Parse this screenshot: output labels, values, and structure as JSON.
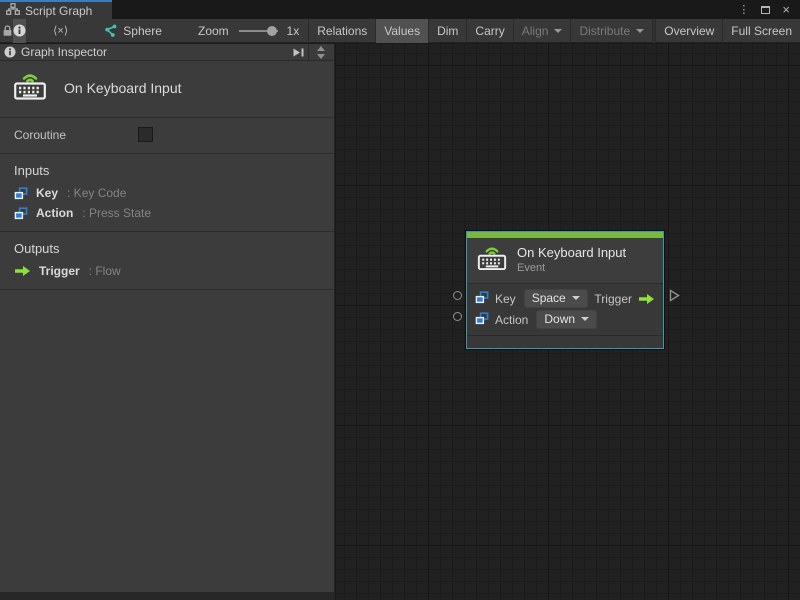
{
  "window": {
    "tab_label": "Script Graph",
    "menu_glyph": "⋮",
    "close_glyph": "×"
  },
  "toolbar": {
    "sphere_label": "Sphere",
    "zoom_label": "Zoom",
    "zoom_value": "1x",
    "code_glyph": "⟨×⟩",
    "buttons": [
      {
        "label": "Relations",
        "state": "normal"
      },
      {
        "label": "Values",
        "state": "selected"
      },
      {
        "label": "Dim",
        "state": "normal"
      },
      {
        "label": "Carry",
        "state": "normal"
      },
      {
        "label": "Align",
        "state": "disabled",
        "caret": true
      },
      {
        "label": "Distribute",
        "state": "disabled",
        "caret": true
      },
      {
        "label": "Overview",
        "state": "normal"
      },
      {
        "label": "Full Screen",
        "state": "normal"
      }
    ]
  },
  "inspector": {
    "title": "Graph Inspector",
    "unit_title": "On Keyboard Input",
    "coroutine_label": "Coroutine",
    "coroutine_checked": false,
    "inputs_header": "Inputs",
    "inputs": [
      {
        "name": "Key",
        "type": ": Key Code"
      },
      {
        "name": "Action",
        "type": ": Press State"
      }
    ],
    "outputs_header": "Outputs",
    "outputs": [
      {
        "name": "Trigger",
        "type": ": Flow"
      }
    ]
  },
  "node": {
    "title": "On Keyboard Input",
    "subtitle": "Event",
    "rows": [
      {
        "label": "Key",
        "value": "Space"
      },
      {
        "label": "Action",
        "value": "Down"
      }
    ],
    "output_label": "Trigger"
  },
  "colors": {
    "tab_accent_blue": "#3c7dbd",
    "event_green": "#79b93f",
    "flow_arrow_green": "#8fe03c",
    "value_port_blue": "#2f7fd4",
    "node_selected_teal": "#3f98a9",
    "signal_arc_green": "#7fd13b"
  }
}
